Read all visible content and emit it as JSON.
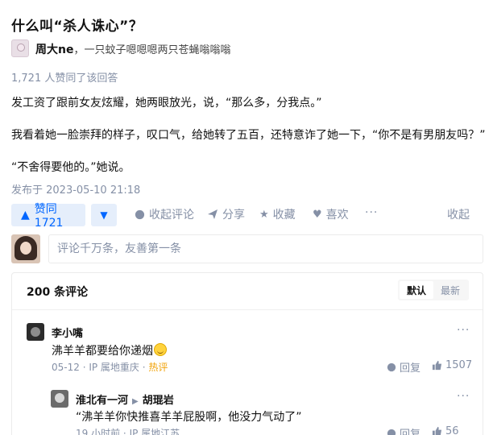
{
  "question": {
    "title": "什么叫“杀人诛心”？"
  },
  "author": {
    "name": "周大ne",
    "bio": "，一只蚊子嗯嗯嗯两只苍蝇嗡嗡嗡"
  },
  "answer": {
    "vote_summary": "1,721 人赞同了该回答",
    "paragraphs": [
      "发工资了跟前女友炫耀，她两眼放光，说，“那么多，分我点。”",
      "我看着她一脸崇拜的样子，叹口气，给她转了五百，还特意诈了她一下，“你不是有男朋友吗？”",
      "“不舍得要他的。”她说。"
    ],
    "published": "发布于 2023-05-10 21:18"
  },
  "actions": {
    "vote_up": "赞同 1721",
    "collapse_comments": "收起评论",
    "share": "分享",
    "collect": "收藏",
    "like": "喜欢",
    "more": "···",
    "fold": "收起"
  },
  "comment_input": {
    "placeholder": "评论千万条，友善第一条"
  },
  "comments": {
    "count_label": "200 条评论",
    "sort": [
      "默认",
      "最新"
    ],
    "items": [
      {
        "author": "李小嘴",
        "text": "沸羊羊都要给你递烟",
        "date": "05-12",
        "location": "IP 属地重庆",
        "hot": "热评",
        "reply": "回复",
        "likes": "1507"
      },
      {
        "author": "淮北有一河",
        "reply_to": "胡琨岩",
        "text": "“沸羊羊你快推喜羊羊屁股啊，他没力气动了”",
        "date": "19 小时前",
        "location": "IP 属地江苏",
        "reply": "回复",
        "likes": "56"
      }
    ]
  },
  "icons": {
    "vote_up": "triangle-up-icon",
    "vote_down": "triangle-down-icon",
    "comment": "speech-bubble-icon",
    "share": "paper-plane-icon",
    "collect": "star-icon",
    "like": "heart-icon",
    "reply": "speech-bubble-icon",
    "thumb": "thumbs-up-icon"
  },
  "colors": {
    "accent": "#0066ff",
    "muted": "#8590a6",
    "hot": "#f1a30b"
  }
}
